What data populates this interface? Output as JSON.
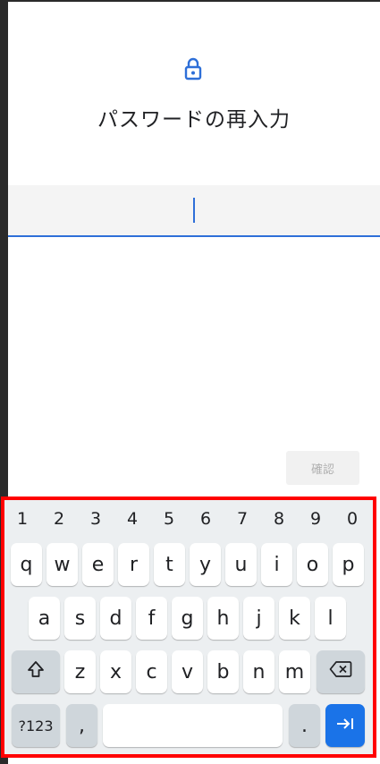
{
  "screen": {
    "title": "パスワードの再入力",
    "password_value": "",
    "confirm_button": "確認",
    "lock_icon": "lock-icon"
  },
  "keyboard": {
    "numbers": [
      "1",
      "2",
      "3",
      "4",
      "5",
      "6",
      "7",
      "8",
      "9",
      "0"
    ],
    "row1": [
      "q",
      "w",
      "e",
      "r",
      "t",
      "y",
      "u",
      "i",
      "o",
      "p"
    ],
    "row2": [
      "a",
      "s",
      "d",
      "f",
      "g",
      "h",
      "j",
      "k",
      "l"
    ],
    "row3": [
      "z",
      "x",
      "c",
      "v",
      "b",
      "n",
      "m"
    ],
    "symbols_key": "?123",
    "comma_key": ",",
    "period_key": ".",
    "shift_icon": "shift-icon",
    "backspace_icon": "backspace-icon",
    "enter_icon": "next-arrow-icon",
    "highlight_color": "#ff0000",
    "accent_color": "#1a73e8"
  }
}
